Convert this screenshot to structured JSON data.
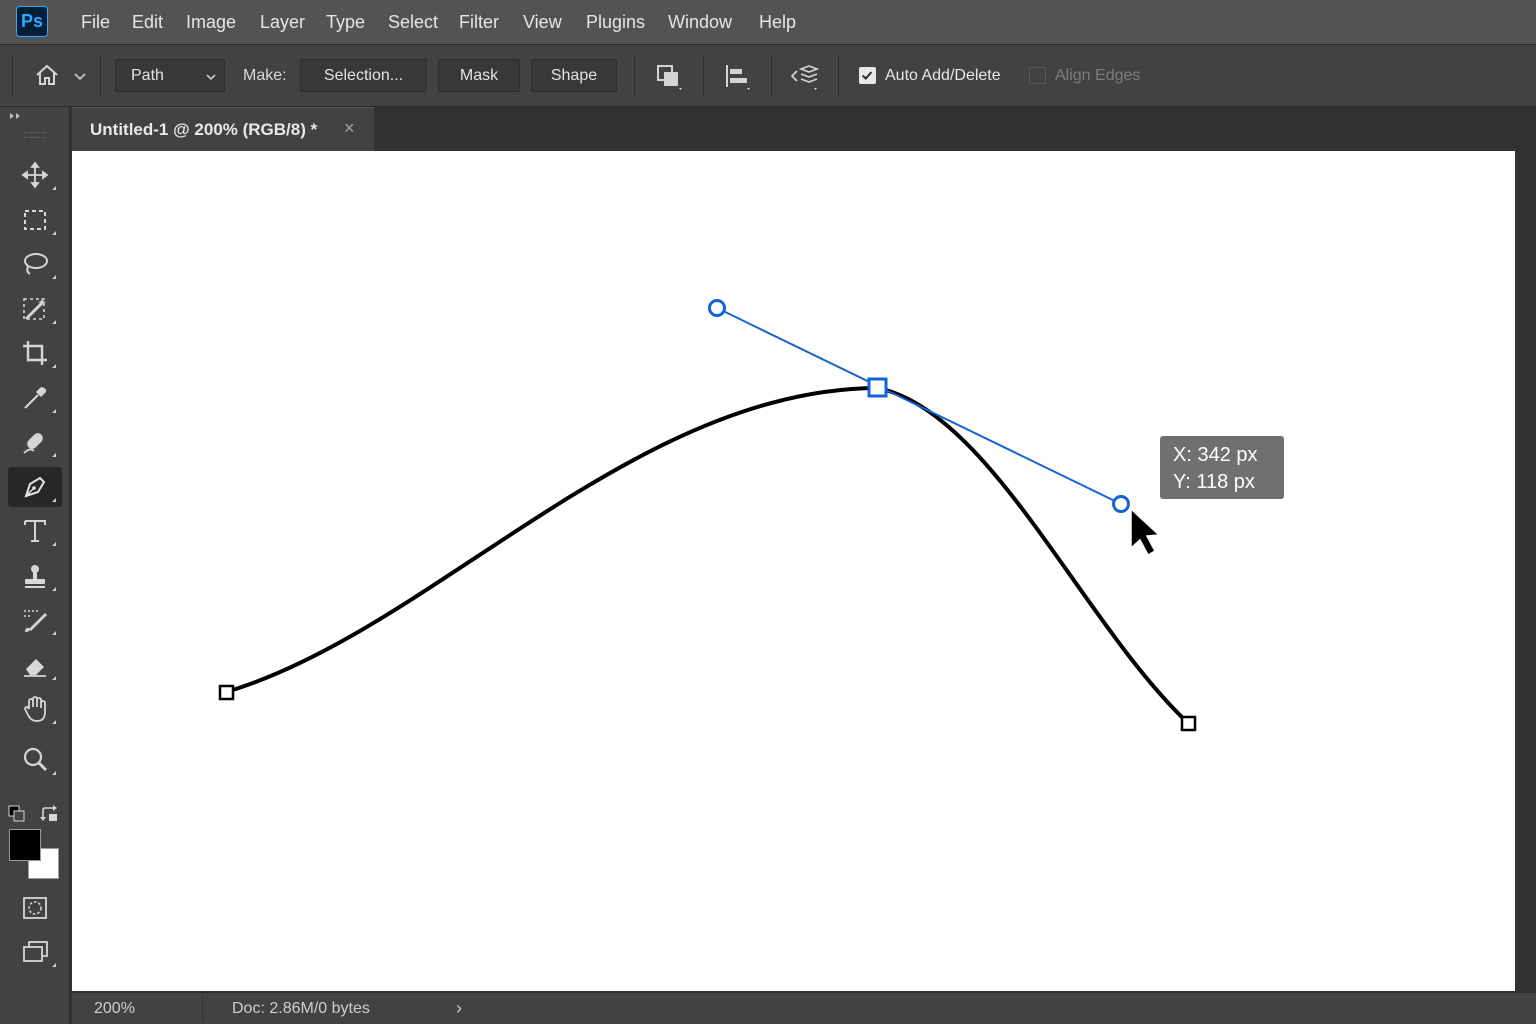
{
  "app": {
    "logo_text": "Ps",
    "accent": "#31a8ff"
  },
  "menu": [
    "File",
    "Edit",
    "Image",
    "Layer",
    "Type",
    "Select",
    "Filter",
    "View",
    "Plugins",
    "Window",
    "Help"
  ],
  "options_bar": {
    "mode_select": "Path",
    "make_label": "Make:",
    "selection_button": "Selection...",
    "mask_button": "Mask",
    "shape_button": "Shape",
    "auto_add_delete": {
      "label": "Auto Add/Delete",
      "checked": true
    },
    "align_edges": {
      "label": "Align Edges",
      "checked": false
    },
    "icons": [
      "home-icon",
      "chevron-down-icon",
      "path-operations-icon",
      "path-alignment-icon",
      "path-arrangement-icon"
    ]
  },
  "document_tab": {
    "title": "Untitled-1 @ 200% (RGB/8) *",
    "close_symbol": "×"
  },
  "toolbar": {
    "tools": [
      "move-tool",
      "marquee-tool",
      "lasso-tool",
      "object-selection-tool",
      "crop-tool",
      "eyedropper-tool",
      "healing-brush-tool",
      "pen-tool",
      "type-tool",
      "clone-stamp-tool",
      "brush-tool",
      "eraser-tool",
      "hand-tool",
      "zoom-tool"
    ],
    "active_tool": "pen-tool",
    "foreground_color": "#000000",
    "background_color": "#ffffff"
  },
  "canvas": {
    "background": "#ffffff",
    "path_color": "#000000",
    "handle_color": "#0a5ccc"
  },
  "tooltip": {
    "x": "X: 342 px",
    "y": "Y: 118 px"
  },
  "status_bar": {
    "zoom": "200%",
    "doc": "Doc: 2.86M/0 bytes",
    "arrow": "›"
  }
}
